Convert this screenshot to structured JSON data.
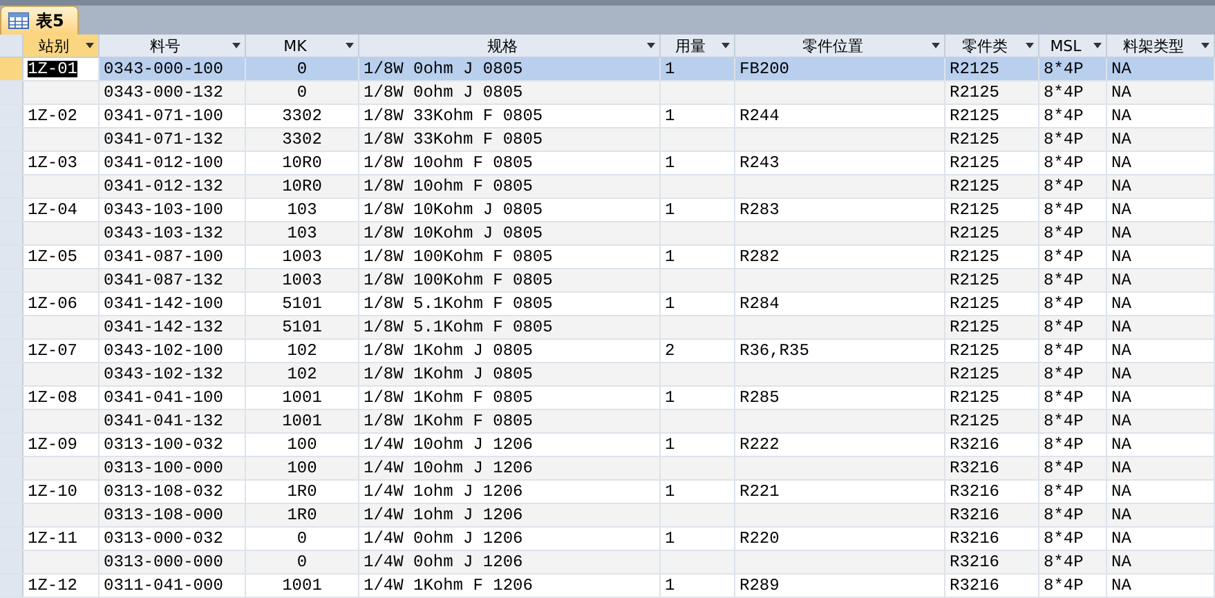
{
  "tab": {
    "title": "表5"
  },
  "columns": [
    {
      "label": "站别",
      "selected": true,
      "kind": "text"
    },
    {
      "label": "料号",
      "selected": false,
      "kind": "text"
    },
    {
      "label": "MK",
      "selected": false,
      "kind": "number"
    },
    {
      "label": "规格",
      "selected": false,
      "kind": "text"
    },
    {
      "label": "用量",
      "selected": false,
      "kind": "text"
    },
    {
      "label": "零件位置",
      "selected": false,
      "kind": "text"
    },
    {
      "label": "零件类",
      "selected": false,
      "kind": "text"
    },
    {
      "label": "MSL",
      "selected": false,
      "kind": "text"
    },
    {
      "label": "料架类型",
      "selected": false,
      "kind": "text"
    }
  ],
  "rows": [
    {
      "selected": true,
      "cells": [
        "1Z-01",
        "0343-000-100",
        "0",
        "1/8W 0ohm J 0805",
        "1",
        "FB200",
        "R2125",
        "8*4P",
        "NA"
      ]
    },
    {
      "selected": false,
      "cells": [
        null,
        "0343-000-132",
        "0",
        "1/8W 0ohm J 0805",
        null,
        null,
        "R2125",
        "8*4P",
        "NA"
      ]
    },
    {
      "selected": false,
      "cells": [
        "1Z-02",
        "0341-071-100",
        "3302",
        "1/8W 33Kohm F 0805",
        "1",
        "R244",
        "R2125",
        "8*4P",
        "NA"
      ]
    },
    {
      "selected": false,
      "cells": [
        null,
        "0341-071-132",
        "3302",
        "1/8W 33Kohm F 0805",
        null,
        null,
        "R2125",
        "8*4P",
        "NA"
      ]
    },
    {
      "selected": false,
      "cells": [
        "1Z-03",
        "0341-012-100",
        "10R0",
        "1/8W 10ohm F 0805",
        "1",
        "R243",
        "R2125",
        "8*4P",
        "NA"
      ]
    },
    {
      "selected": false,
      "cells": [
        null,
        "0341-012-132",
        "10R0",
        "1/8W 10ohm F 0805",
        null,
        null,
        "R2125",
        "8*4P",
        "NA"
      ]
    },
    {
      "selected": false,
      "cells": [
        "1Z-04",
        "0343-103-100",
        "103",
        "1/8W 10Kohm J 0805",
        "1",
        "R283",
        "R2125",
        "8*4P",
        "NA"
      ]
    },
    {
      "selected": false,
      "cells": [
        null,
        "0343-103-132",
        "103",
        "1/8W 10Kohm J 0805",
        null,
        null,
        "R2125",
        "8*4P",
        "NA"
      ]
    },
    {
      "selected": false,
      "cells": [
        "1Z-05",
        "0341-087-100",
        "1003",
        "1/8W 100Kohm F 0805",
        "1",
        "R282",
        "R2125",
        "8*4P",
        "NA"
      ]
    },
    {
      "selected": false,
      "cells": [
        null,
        "0341-087-132",
        "1003",
        "1/8W 100Kohm F 0805",
        null,
        null,
        "R2125",
        "8*4P",
        "NA"
      ]
    },
    {
      "selected": false,
      "cells": [
        "1Z-06",
        "0341-142-100",
        "5101",
        "1/8W 5.1Kohm F 0805",
        "1",
        "R284",
        "R2125",
        "8*4P",
        "NA"
      ]
    },
    {
      "selected": false,
      "cells": [
        null,
        "0341-142-132",
        "5101",
        "1/8W 5.1Kohm F 0805",
        null,
        null,
        "R2125",
        "8*4P",
        "NA"
      ]
    },
    {
      "selected": false,
      "cells": [
        "1Z-07",
        "0343-102-100",
        "102",
        "1/8W 1Kohm J 0805",
        "2",
        "R36,R35",
        "R2125",
        "8*4P",
        "NA"
      ]
    },
    {
      "selected": false,
      "cells": [
        null,
        "0343-102-132",
        "102",
        "1/8W 1Kohm J 0805",
        null,
        null,
        "R2125",
        "8*4P",
        "NA"
      ]
    },
    {
      "selected": false,
      "cells": [
        "1Z-08",
        "0341-041-100",
        "1001",
        "1/8W 1Kohm F 0805",
        "1",
        "R285",
        "R2125",
        "8*4P",
        "NA"
      ]
    },
    {
      "selected": false,
      "cells": [
        null,
        "0341-041-132",
        "1001",
        "1/8W 1Kohm F 0805",
        null,
        null,
        "R2125",
        "8*4P",
        "NA"
      ]
    },
    {
      "selected": false,
      "cells": [
        "1Z-09",
        "0313-100-032",
        "100",
        "1/4W 10ohm J 1206",
        "1",
        "R222",
        "R3216",
        "8*4P",
        "NA"
      ]
    },
    {
      "selected": false,
      "cells": [
        null,
        "0313-100-000",
        "100",
        "1/4W 10ohm J 1206",
        null,
        null,
        "R3216",
        "8*4P",
        "NA"
      ]
    },
    {
      "selected": false,
      "cells": [
        "1Z-10",
        "0313-108-032",
        "1R0",
        "1/4W 1ohm J 1206",
        "1",
        "R221",
        "R3216",
        "8*4P",
        "NA"
      ]
    },
    {
      "selected": false,
      "cells": [
        null,
        "0313-108-000",
        "1R0",
        "1/4W 1ohm J 1206",
        null,
        null,
        "R3216",
        "8*4P",
        "NA"
      ]
    },
    {
      "selected": false,
      "cells": [
        "1Z-11",
        "0313-000-032",
        "0",
        "1/4W 0ohm J 1206",
        "1",
        "R220",
        "R3216",
        "8*4P",
        "NA"
      ]
    },
    {
      "selected": false,
      "cells": [
        null,
        "0313-000-000",
        "0",
        "1/4W 0ohm J 1206",
        null,
        null,
        "R3216",
        "8*4P",
        "NA"
      ]
    },
    {
      "selected": false,
      "cells": [
        "1Z-12",
        "0311-041-000",
        "1001",
        "1/4W 1Kohm F 1206",
        "1",
        "R289",
        "R3216",
        "8*4P",
        "NA"
      ]
    }
  ]
}
